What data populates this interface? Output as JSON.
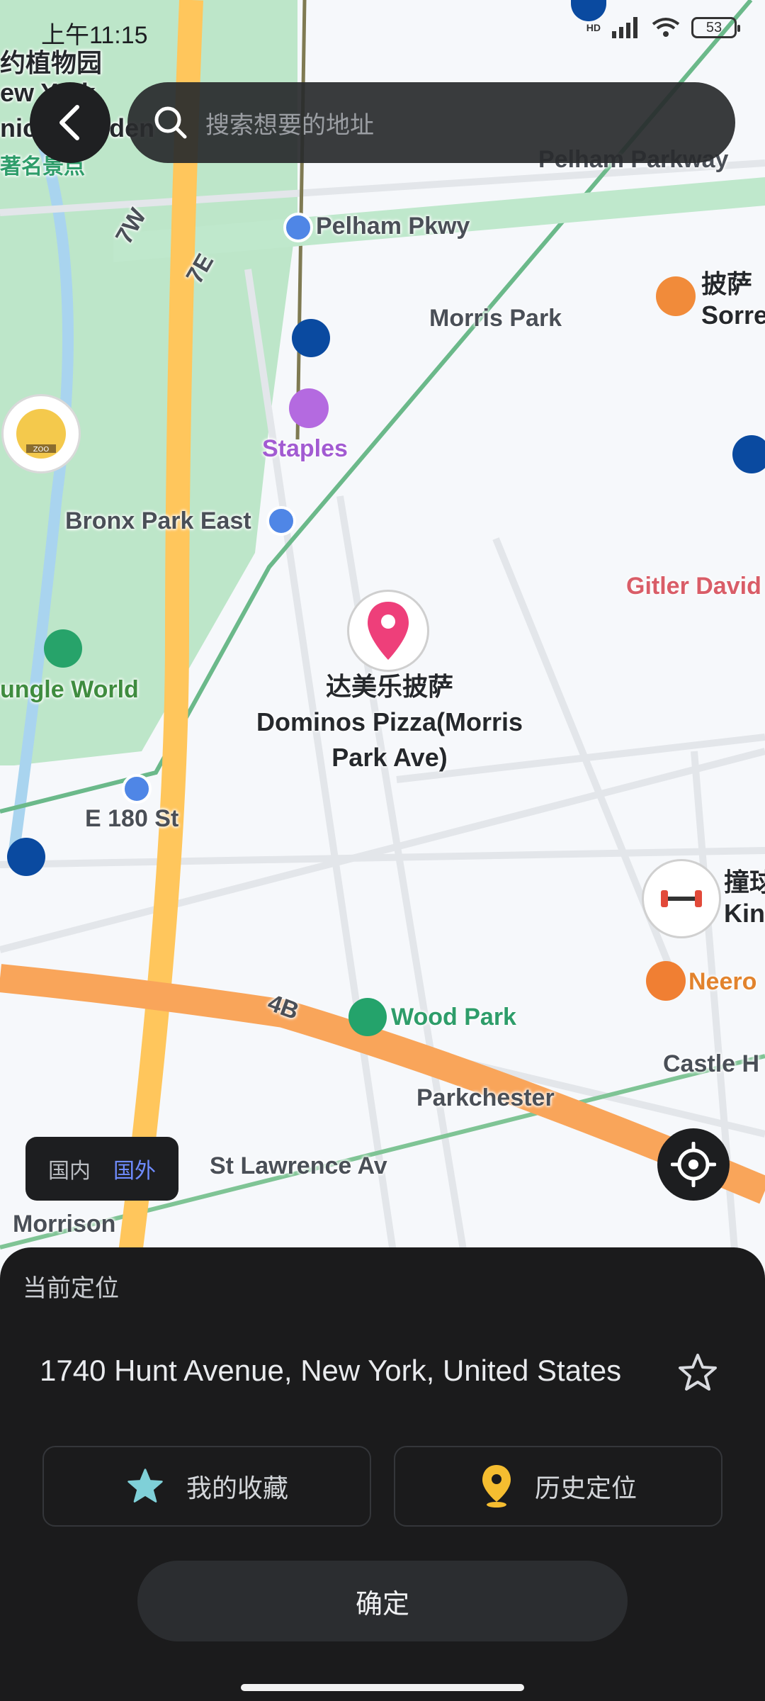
{
  "status_bar": {
    "time": "上午11:15",
    "network": "HD",
    "battery": "53"
  },
  "search": {
    "placeholder": "搜索想要的地址"
  },
  "map": {
    "labels": {
      "botanical_garden_cn": "约植物园",
      "botanical_garden_en1": "ew York",
      "botanical_garden_en2": "nical Garden",
      "famous_spot": "著名景点",
      "pelham_parkway": "Pelham Parkway",
      "pelham_pkwy_station": "Pelham Pkwy",
      "morris_park": "Morris Park",
      "pizza_sorrento_cn": "披萨",
      "pizza_sorrento_en": "Sorre",
      "staples": "Staples",
      "bronx_park_east": "Bronx Park East",
      "gitler": "Gitler David",
      "jungle_world": "ungle World",
      "selected_poi_cn": "达美乐披萨",
      "selected_poi_en1": "Dominos Pizza(Morris",
      "selected_poi_en2": "Park Ave)",
      "e180_st": "E 180 St",
      "gym_cn": "撞球",
      "gym_en": "Kin",
      "neero": "Neero",
      "wood_park": "Wood Park",
      "castle_hill": "Castle H",
      "parkchester": "Parkchester",
      "st_lawrence": "St Lawrence Av",
      "morrison": "Morrison",
      "route_4b": "4B",
      "route_7w": "7W",
      "route_7e": "7E",
      "zoo_badge": "ZOO"
    }
  },
  "region_toggle": {
    "domestic": "国内",
    "overseas": "国外"
  },
  "bottom_sheet": {
    "title": "当前定位",
    "address": "1740 Hunt Avenue, New York, United States",
    "my_favorites": "我的收藏",
    "history_location": "历史定位",
    "confirm": "确定"
  },
  "colors": {
    "accent_blue": "#6f8cff",
    "pin_pink": "#ee3f7a",
    "star_teal": "#7fd0d8",
    "history_yellow": "#f5bd30",
    "sheet_bg": "#1b1b1c"
  }
}
